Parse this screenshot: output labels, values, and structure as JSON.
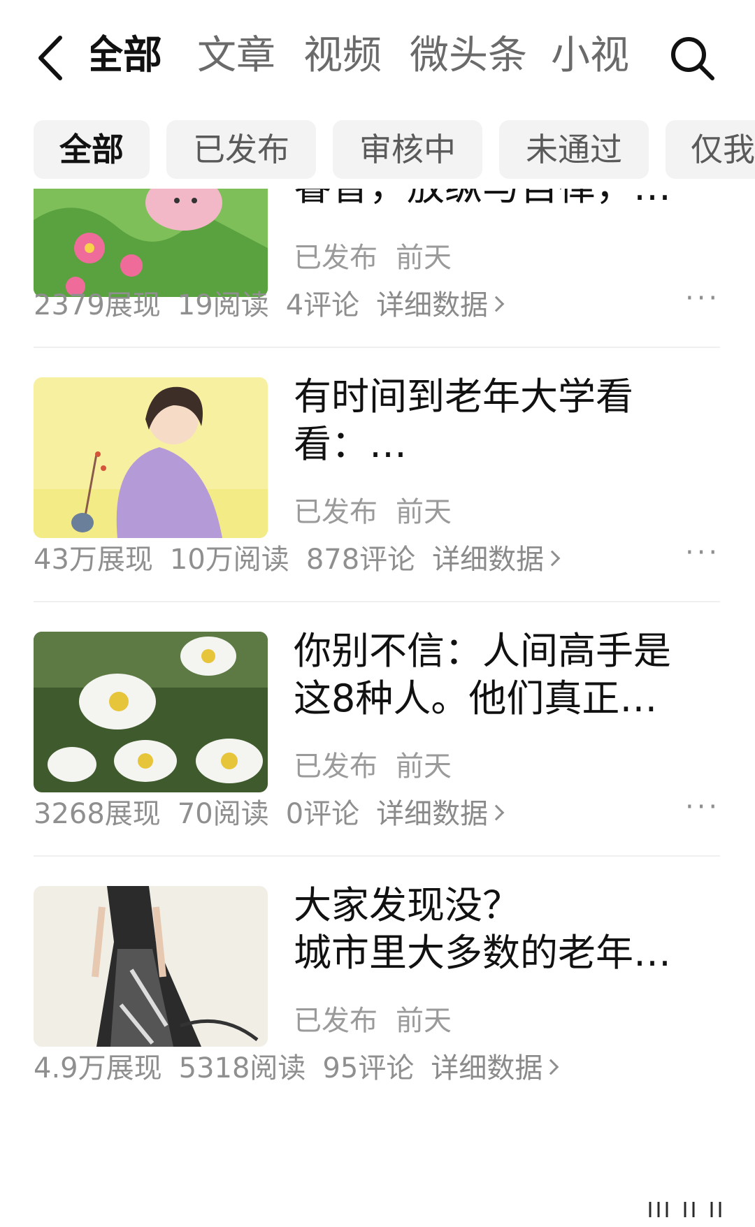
{
  "top_tabs": [
    {
      "label": "全部",
      "active": true
    },
    {
      "label": "文章",
      "active": false
    },
    {
      "label": "视频",
      "active": false
    },
    {
      "label": "微头条",
      "active": false
    },
    {
      "label": "小视",
      "active": false
    }
  ],
  "filter_chips": [
    {
      "label": "全部",
      "active": true
    },
    {
      "label": "已发布",
      "active": false
    },
    {
      "label": "审核中",
      "active": false
    },
    {
      "label": "未通过",
      "active": false
    },
    {
      "label": "仅我",
      "active": false
    }
  ],
  "items": [
    {
      "title_lines": [
        "睿智，放纵与自律，…"
      ],
      "status": "已发布",
      "time": "前天",
      "views": "2379展现",
      "reads": "19阅读",
      "comments": "4评论",
      "detail": "详细数据",
      "more": "···",
      "thumb": "mouse-flowers"
    },
    {
      "title_lines": [
        "有时间到老年大学看",
        "看：…"
      ],
      "status": "已发布",
      "time": "前天",
      "views": "43万展现",
      "reads": "10万阅读",
      "comments": "878评论",
      "detail": "详细数据",
      "more": "···",
      "thumb": "woman-purple"
    },
    {
      "title_lines": [
        "你别不信：人间高手是",
        "这8种人。他们真正…"
      ],
      "status": "已发布",
      "time": "前天",
      "views": "3268展现",
      "reads": "70阅读",
      "comments": "0评论",
      "detail": "详细数据",
      "more": "···",
      "thumb": "daisies"
    },
    {
      "title_lines": [
        "大家发现没？",
        "城市里大多数的老年…"
      ],
      "status": "已发布",
      "time": "前天",
      "views": "4.9万展现",
      "reads": "5318阅读",
      "comments": "95评论",
      "detail": "详细数据",
      "more": "",
      "thumb": "ink-dress"
    }
  ],
  "colors": {
    "text": "#111111",
    "muted": "#8f8f8f",
    "chip_bg": "#f3f3f3",
    "divider": "#efefef"
  }
}
